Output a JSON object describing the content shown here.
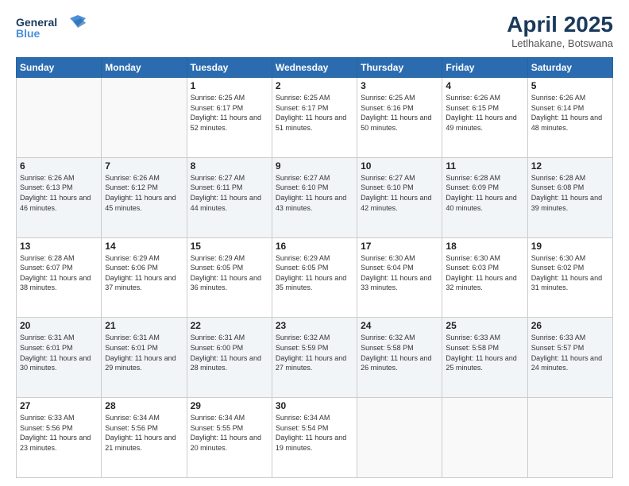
{
  "logo": {
    "line1": "General",
    "line2": "Blue"
  },
  "title": "April 2025",
  "subtitle": "Letlhakane, Botswana",
  "days_of_week": [
    "Sunday",
    "Monday",
    "Tuesday",
    "Wednesday",
    "Thursday",
    "Friday",
    "Saturday"
  ],
  "weeks": [
    [
      {
        "day": "",
        "empty": true
      },
      {
        "day": "",
        "empty": true
      },
      {
        "day": "1",
        "sunrise": "Sunrise: 6:25 AM",
        "sunset": "Sunset: 6:17 PM",
        "daylight": "Daylight: 11 hours and 52 minutes."
      },
      {
        "day": "2",
        "sunrise": "Sunrise: 6:25 AM",
        "sunset": "Sunset: 6:17 PM",
        "daylight": "Daylight: 11 hours and 51 minutes."
      },
      {
        "day": "3",
        "sunrise": "Sunrise: 6:25 AM",
        "sunset": "Sunset: 6:16 PM",
        "daylight": "Daylight: 11 hours and 50 minutes."
      },
      {
        "day": "4",
        "sunrise": "Sunrise: 6:26 AM",
        "sunset": "Sunset: 6:15 PM",
        "daylight": "Daylight: 11 hours and 49 minutes."
      },
      {
        "day": "5",
        "sunrise": "Sunrise: 6:26 AM",
        "sunset": "Sunset: 6:14 PM",
        "daylight": "Daylight: 11 hours and 48 minutes."
      }
    ],
    [
      {
        "day": "6",
        "sunrise": "Sunrise: 6:26 AM",
        "sunset": "Sunset: 6:13 PM",
        "daylight": "Daylight: 11 hours and 46 minutes."
      },
      {
        "day": "7",
        "sunrise": "Sunrise: 6:26 AM",
        "sunset": "Sunset: 6:12 PM",
        "daylight": "Daylight: 11 hours and 45 minutes."
      },
      {
        "day": "8",
        "sunrise": "Sunrise: 6:27 AM",
        "sunset": "Sunset: 6:11 PM",
        "daylight": "Daylight: 11 hours and 44 minutes."
      },
      {
        "day": "9",
        "sunrise": "Sunrise: 6:27 AM",
        "sunset": "Sunset: 6:10 PM",
        "daylight": "Daylight: 11 hours and 43 minutes."
      },
      {
        "day": "10",
        "sunrise": "Sunrise: 6:27 AM",
        "sunset": "Sunset: 6:10 PM",
        "daylight": "Daylight: 11 hours and 42 minutes."
      },
      {
        "day": "11",
        "sunrise": "Sunrise: 6:28 AM",
        "sunset": "Sunset: 6:09 PM",
        "daylight": "Daylight: 11 hours and 40 minutes."
      },
      {
        "day": "12",
        "sunrise": "Sunrise: 6:28 AM",
        "sunset": "Sunset: 6:08 PM",
        "daylight": "Daylight: 11 hours and 39 minutes."
      }
    ],
    [
      {
        "day": "13",
        "sunrise": "Sunrise: 6:28 AM",
        "sunset": "Sunset: 6:07 PM",
        "daylight": "Daylight: 11 hours and 38 minutes."
      },
      {
        "day": "14",
        "sunrise": "Sunrise: 6:29 AM",
        "sunset": "Sunset: 6:06 PM",
        "daylight": "Daylight: 11 hours and 37 minutes."
      },
      {
        "day": "15",
        "sunrise": "Sunrise: 6:29 AM",
        "sunset": "Sunset: 6:05 PM",
        "daylight": "Daylight: 11 hours and 36 minutes."
      },
      {
        "day": "16",
        "sunrise": "Sunrise: 6:29 AM",
        "sunset": "Sunset: 6:05 PM",
        "daylight": "Daylight: 11 hours and 35 minutes."
      },
      {
        "day": "17",
        "sunrise": "Sunrise: 6:30 AM",
        "sunset": "Sunset: 6:04 PM",
        "daylight": "Daylight: 11 hours and 33 minutes."
      },
      {
        "day": "18",
        "sunrise": "Sunrise: 6:30 AM",
        "sunset": "Sunset: 6:03 PM",
        "daylight": "Daylight: 11 hours and 32 minutes."
      },
      {
        "day": "19",
        "sunrise": "Sunrise: 6:30 AM",
        "sunset": "Sunset: 6:02 PM",
        "daylight": "Daylight: 11 hours and 31 minutes."
      }
    ],
    [
      {
        "day": "20",
        "sunrise": "Sunrise: 6:31 AM",
        "sunset": "Sunset: 6:01 PM",
        "daylight": "Daylight: 11 hours and 30 minutes."
      },
      {
        "day": "21",
        "sunrise": "Sunrise: 6:31 AM",
        "sunset": "Sunset: 6:01 PM",
        "daylight": "Daylight: 11 hours and 29 minutes."
      },
      {
        "day": "22",
        "sunrise": "Sunrise: 6:31 AM",
        "sunset": "Sunset: 6:00 PM",
        "daylight": "Daylight: 11 hours and 28 minutes."
      },
      {
        "day": "23",
        "sunrise": "Sunrise: 6:32 AM",
        "sunset": "Sunset: 5:59 PM",
        "daylight": "Daylight: 11 hours and 27 minutes."
      },
      {
        "day": "24",
        "sunrise": "Sunrise: 6:32 AM",
        "sunset": "Sunset: 5:58 PM",
        "daylight": "Daylight: 11 hours and 26 minutes."
      },
      {
        "day": "25",
        "sunrise": "Sunrise: 6:33 AM",
        "sunset": "Sunset: 5:58 PM",
        "daylight": "Daylight: 11 hours and 25 minutes."
      },
      {
        "day": "26",
        "sunrise": "Sunrise: 6:33 AM",
        "sunset": "Sunset: 5:57 PM",
        "daylight": "Daylight: 11 hours and 24 minutes."
      }
    ],
    [
      {
        "day": "27",
        "sunrise": "Sunrise: 6:33 AM",
        "sunset": "Sunset: 5:56 PM",
        "daylight": "Daylight: 11 hours and 23 minutes."
      },
      {
        "day": "28",
        "sunrise": "Sunrise: 6:34 AM",
        "sunset": "Sunset: 5:56 PM",
        "daylight": "Daylight: 11 hours and 21 minutes."
      },
      {
        "day": "29",
        "sunrise": "Sunrise: 6:34 AM",
        "sunset": "Sunset: 5:55 PM",
        "daylight": "Daylight: 11 hours and 20 minutes."
      },
      {
        "day": "30",
        "sunrise": "Sunrise: 6:34 AM",
        "sunset": "Sunset: 5:54 PM",
        "daylight": "Daylight: 11 hours and 19 minutes."
      },
      {
        "day": "",
        "empty": true
      },
      {
        "day": "",
        "empty": true
      },
      {
        "day": "",
        "empty": true
      }
    ]
  ]
}
